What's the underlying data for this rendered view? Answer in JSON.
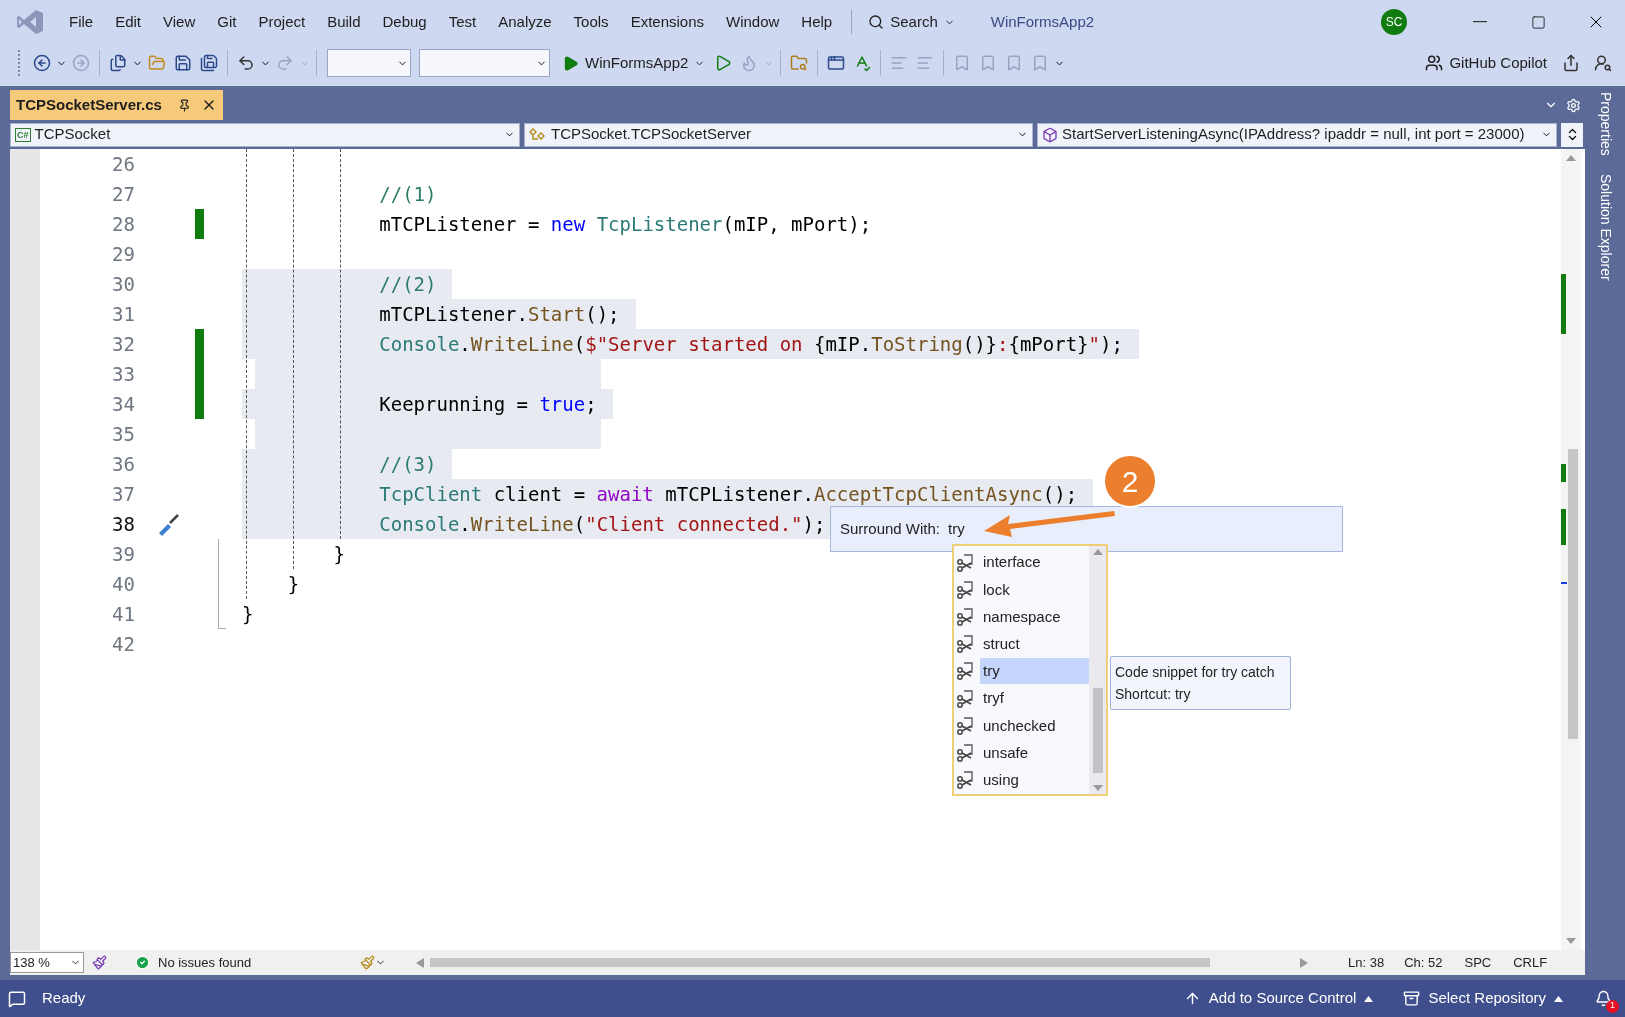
{
  "window": {
    "title": "WinFormsApp2",
    "account_initials": "SC"
  },
  "menu": [
    "File",
    "Edit",
    "View",
    "Git",
    "Project",
    "Build",
    "Debug",
    "Test",
    "Analyze",
    "Tools",
    "Extensions",
    "Window",
    "Help"
  ],
  "search": {
    "label": "Search"
  },
  "toolbar": {
    "startup_project": "WinFormsApp2",
    "copilot": "GitHub Copilot"
  },
  "tabs": [
    {
      "label": "TCPSocketServer.cs",
      "selected": true
    }
  ],
  "navigation_bar": {
    "project_icon": "C#",
    "project": "TCPSocket",
    "type": "TCPSocket.TCPSocketServer",
    "member": "StartServerListeningAsync(IPAddress? ipaddr = null, int port = 23000)"
  },
  "side_panels": [
    "Properties",
    "Solution Explorer"
  ],
  "editor": {
    "lines": [
      {
        "number": "26",
        "highlighted": false,
        "changed": false,
        "current": false
      },
      {
        "number": "27",
        "highlighted": false,
        "changed": false,
        "current": false,
        "tokens": [
          {
            "kind": "comment",
            "text": "            //(1)"
          }
        ]
      },
      {
        "number": "28",
        "highlighted": false,
        "changed": true,
        "current": false,
        "tokens": [
          {
            "kind": "plain",
            "text": "            mTCPListener = "
          },
          {
            "kind": "keyword",
            "text": "new"
          },
          {
            "kind": "type",
            "text": " TcpListener"
          },
          {
            "kind": "plain",
            "text": "(mIP, mPort);"
          }
        ]
      },
      {
        "number": "29",
        "highlighted": false,
        "changed": false,
        "current": false
      },
      {
        "number": "30",
        "highlighted": true,
        "changed": false,
        "current": false,
        "tokens": [
          {
            "kind": "comment",
            "text": "            //(2)"
          }
        ]
      },
      {
        "number": "31",
        "highlighted": true,
        "changed": false,
        "current": false,
        "tokens": [
          {
            "kind": "plain",
            "text": "            mTCPListener."
          },
          {
            "kind": "method",
            "text": "Start"
          },
          {
            "kind": "plain",
            "text": "();"
          }
        ]
      },
      {
        "number": "32",
        "highlighted": true,
        "changed": true,
        "current": false,
        "tokens": [
          {
            "kind": "type",
            "text": "            Console"
          },
          {
            "kind": "plain",
            "text": "."
          },
          {
            "kind": "method",
            "text": "WriteLine"
          },
          {
            "kind": "plain",
            "text": "("
          },
          {
            "kind": "string",
            "text": "$\"Server started on "
          },
          {
            "kind": "plain",
            "text": "{mIP."
          },
          {
            "kind": "method",
            "text": "ToString"
          },
          {
            "kind": "plain",
            "text": "()}"
          },
          {
            "kind": "string",
            "text": ":"
          },
          {
            "kind": "plain",
            "text": "{mPort}"
          },
          {
            "kind": "string",
            "text": "\""
          },
          {
            "kind": "plain",
            "text": ");"
          }
        ]
      },
      {
        "number": "33",
        "highlighted": true,
        "changed": true,
        "current": false
      },
      {
        "number": "34",
        "highlighted": true,
        "changed": true,
        "current": false,
        "tokens": [
          {
            "kind": "plain",
            "text": "            Keeprunning = "
          },
          {
            "kind": "keyword",
            "text": "true"
          },
          {
            "kind": "plain",
            "text": ";"
          }
        ]
      },
      {
        "number": "35",
        "highlighted": true,
        "changed": false,
        "current": false
      },
      {
        "number": "36",
        "highlighted": true,
        "changed": false,
        "current": false,
        "tokens": [
          {
            "kind": "comment",
            "text": "            //(3)"
          }
        ]
      },
      {
        "number": "37",
        "highlighted": true,
        "changed": false,
        "current": false,
        "tokens": [
          {
            "kind": "type",
            "text": "            TcpClient"
          },
          {
            "kind": "plain",
            "text": " client = "
          },
          {
            "kind": "control",
            "text": "await"
          },
          {
            "kind": "plain",
            "text": " mTCPListener."
          },
          {
            "kind": "method",
            "text": "AcceptTcpClientAsync"
          },
          {
            "kind": "plain",
            "text": "();"
          }
        ]
      },
      {
        "number": "38",
        "highlighted": true,
        "changed": false,
        "current": true,
        "quick_action": true,
        "tokens": [
          {
            "kind": "type",
            "text": "            Console"
          },
          {
            "kind": "plain",
            "text": "."
          },
          {
            "kind": "method",
            "text": "WriteLine"
          },
          {
            "kind": "plain",
            "text": "("
          },
          {
            "kind": "string",
            "text": "\"Client connected.\""
          },
          {
            "kind": "plain",
            "text": ");"
          }
        ]
      },
      {
        "number": "39",
        "highlighted": false,
        "changed": false,
        "current": false,
        "tokens": [
          {
            "kind": "plain",
            "text": "        }"
          }
        ]
      },
      {
        "number": "40",
        "highlighted": false,
        "changed": false,
        "current": false,
        "tokens": [
          {
            "kind": "plain",
            "text": "    }"
          }
        ]
      },
      {
        "number": "41",
        "highlighted": false,
        "changed": false,
        "current": false,
        "tokens": [
          {
            "kind": "plain",
            "text": "}"
          }
        ]
      },
      {
        "number": "42",
        "highlighted": false,
        "changed": false,
        "current": false
      }
    ]
  },
  "surround_with": {
    "label": "Surround With:",
    "value": "try",
    "items": [
      {
        "label": "interface",
        "selected": false
      },
      {
        "label": "lock",
        "selected": false
      },
      {
        "label": "namespace",
        "selected": false
      },
      {
        "label": "struct",
        "selected": false
      },
      {
        "label": "try",
        "selected": true
      },
      {
        "label": "tryf",
        "selected": false
      },
      {
        "label": "unchecked",
        "selected": false
      },
      {
        "label": "unsafe",
        "selected": false
      },
      {
        "label": "using",
        "selected": false
      }
    ],
    "tooltip": [
      "Code snippet for try catch",
      "Shortcut: try"
    ]
  },
  "callout": {
    "number": "2"
  },
  "editor_status": {
    "zoom": "138 %",
    "issues": "No issues found",
    "line": "Ln: 38",
    "column": "Ch: 52",
    "whitespace": "SPC",
    "line_endings": "CRLF"
  },
  "status_bar": {
    "state": "Ready",
    "source_control": "Add to Source Control",
    "repository": "Select Repository",
    "notifications": "1"
  }
}
